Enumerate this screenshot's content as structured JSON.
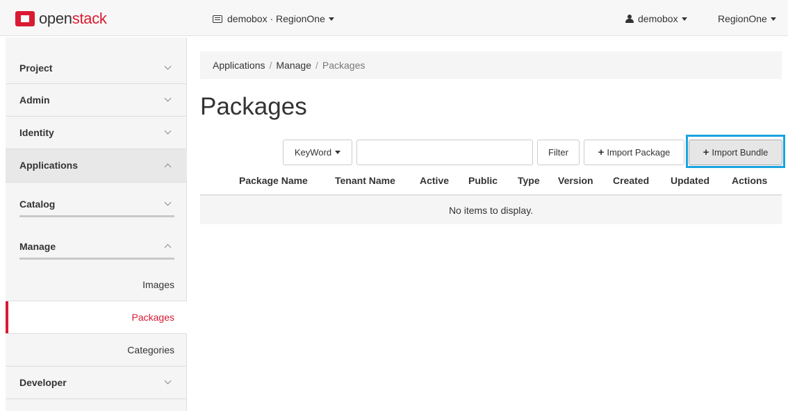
{
  "brand": {
    "name_plain": "open",
    "name_accent": "stack",
    "color": "#da1a32"
  },
  "navbar": {
    "project_switcher": "demobox · RegionOne",
    "user": "demobox",
    "region": "RegionOne"
  },
  "sidebar": {
    "sections": [
      {
        "label": "Project",
        "expanded": false
      },
      {
        "label": "Admin",
        "expanded": false
      },
      {
        "label": "Identity",
        "expanded": false
      },
      {
        "label": "Applications",
        "expanded": true
      },
      {
        "label": "Catalog",
        "expanded": false
      },
      {
        "label": "Manage",
        "expanded": true
      },
      {
        "label": "Developer",
        "expanded": false
      }
    ],
    "manage_items": [
      {
        "label": "Images",
        "active": false
      },
      {
        "label": "Packages",
        "active": true
      },
      {
        "label": "Categories",
        "active": false
      }
    ]
  },
  "breadcrumb": [
    "Applications",
    "Manage",
    "Packages"
  ],
  "page_title": "Packages",
  "toolbar": {
    "filter_type": "KeyWord",
    "search_value": "",
    "filter_label": "Filter",
    "import_package_label": "Import Package",
    "import_bundle_label": "Import Bundle"
  },
  "table": {
    "columns": [
      "Package Name",
      "Tenant Name",
      "Active",
      "Public",
      "Type",
      "Version",
      "Created",
      "Updated",
      "Actions"
    ],
    "empty_message": "No items to display."
  },
  "colors": {
    "accent": "#da1a32",
    "highlight": "#1aa3e0"
  }
}
